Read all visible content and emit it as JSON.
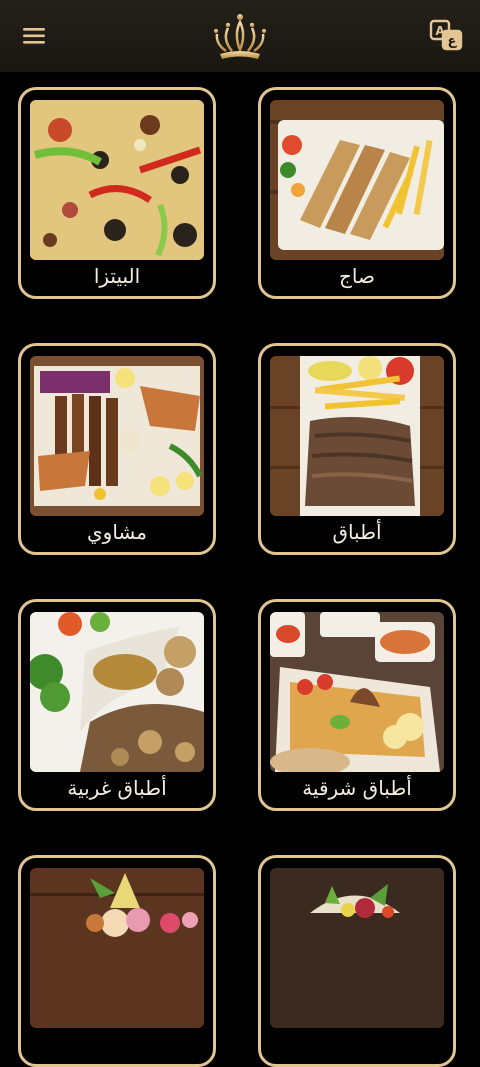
{
  "header": {
    "menu_icon": "hamburger-menu-icon",
    "logo_icon": "crown-logo-icon",
    "language_icon": "language-switch-icon",
    "language_glyph_a": "A",
    "language_glyph_b": "ع"
  },
  "colors": {
    "accent_gold": "#e2c592",
    "background": "#000000",
    "header_bg": "#1f1b15"
  },
  "categories": [
    {
      "label": "البيتزا",
      "image": "pizza-photo"
    },
    {
      "label": "صاج",
      "image": "saj-wrap-photo"
    },
    {
      "label": "مشاوي",
      "image": "grilled-platter-photo"
    },
    {
      "label": "أطباق",
      "image": "shawarma-plate-photo"
    },
    {
      "label": "أطباق غربية",
      "image": "western-dish-photo"
    },
    {
      "label": "أطباق شرقية",
      "image": "eastern-dish-photo"
    },
    {
      "label": "",
      "image": "dessert-photo"
    },
    {
      "label": "",
      "image": "salad-photo"
    }
  ]
}
